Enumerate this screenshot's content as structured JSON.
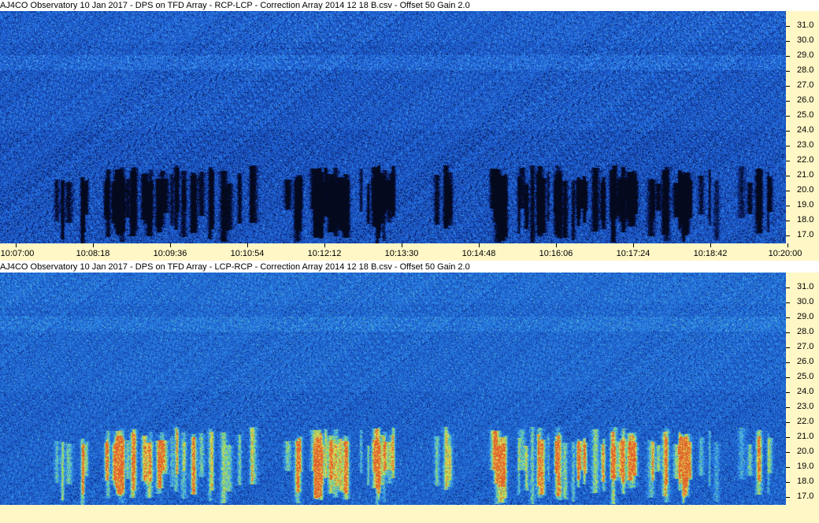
{
  "chart_data": [
    {
      "type": "heatmap",
      "title": "AJ4CO Observatory 10 Jan 2017  -  DPS on TFD Array  -  RCP-LCP  -  Correction Array 2014 12 18 B.csv  -  Offset 50  Gain 2.0",
      "x_ticks": [
        "10:07:00",
        "10:08:18",
        "10:09:36",
        "10:10:54",
        "10:12:12",
        "10:13:30",
        "10:14:48",
        "10:16:06",
        "10:17:24",
        "10:18:42",
        "10:20:00"
      ],
      "xlim": [
        "10:07:00",
        "10:20:00"
      ],
      "y_ticks": [
        "17.0",
        "18.0",
        "19.0",
        "20.0",
        "21.0",
        "22.0",
        "23.0",
        "24.0",
        "25.0",
        "26.0",
        "27.0",
        "28.0",
        "29.0",
        "30.0",
        "31.0"
      ],
      "ylim": [
        16.5,
        32
      ],
      "polarity": "RCP-LCP",
      "emission_style": "dark bursts on blue background",
      "colors": {
        "background": "#1e5ccc",
        "burst": "#04091e"
      }
    },
    {
      "type": "heatmap",
      "title": "AJ4CO Observatory 10 Jan 2017  -  DPS on TFD Array  -  LCP-RCP  -  Correction Array 2014 12 18 B.csv  -  Offset 50  Gain 2.0",
      "x_ticks": [],
      "y_ticks": [
        "17.0",
        "18.0",
        "19.0",
        "20.0",
        "21.0",
        "22.0",
        "23.0",
        "24.0",
        "25.0",
        "26.0",
        "27.0",
        "28.0",
        "29.0",
        "30.0",
        "31.0"
      ],
      "ylim": [
        16.5,
        32
      ],
      "polarity": "LCP-RCP",
      "emission_style": "bright green/yellow/red bursts on blue background",
      "colors": {
        "background": "#1e5ccc",
        "burst_low": "#7ad86a",
        "burst_mid": "#e8d84c",
        "burst_high": "#e05a2a"
      }
    }
  ]
}
